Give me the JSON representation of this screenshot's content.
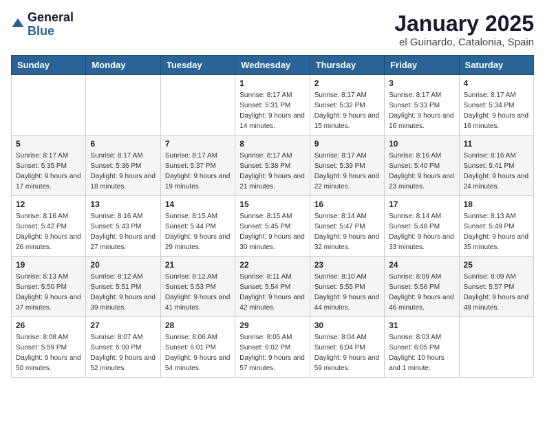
{
  "logo": {
    "general": "General",
    "blue": "Blue"
  },
  "header": {
    "month": "January 2025",
    "location": "el Guinardo, Catalonia, Spain"
  },
  "weekdays": [
    "Sunday",
    "Monday",
    "Tuesday",
    "Wednesday",
    "Thursday",
    "Friday",
    "Saturday"
  ],
  "weeks": [
    [
      {
        "day": "",
        "sunrise": "",
        "sunset": "",
        "daylight": ""
      },
      {
        "day": "",
        "sunrise": "",
        "sunset": "",
        "daylight": ""
      },
      {
        "day": "",
        "sunrise": "",
        "sunset": "",
        "daylight": ""
      },
      {
        "day": "1",
        "sunrise": "Sunrise: 8:17 AM",
        "sunset": "Sunset: 5:31 PM",
        "daylight": "Daylight: 9 hours and 14 minutes."
      },
      {
        "day": "2",
        "sunrise": "Sunrise: 8:17 AM",
        "sunset": "Sunset: 5:32 PM",
        "daylight": "Daylight: 9 hours and 15 minutes."
      },
      {
        "day": "3",
        "sunrise": "Sunrise: 8:17 AM",
        "sunset": "Sunset: 5:33 PM",
        "daylight": "Daylight: 9 hours and 16 minutes."
      },
      {
        "day": "4",
        "sunrise": "Sunrise: 8:17 AM",
        "sunset": "Sunset: 5:34 PM",
        "daylight": "Daylight: 9 hours and 16 minutes."
      }
    ],
    [
      {
        "day": "5",
        "sunrise": "Sunrise: 8:17 AM",
        "sunset": "Sunset: 5:35 PM",
        "daylight": "Daylight: 9 hours and 17 minutes."
      },
      {
        "day": "6",
        "sunrise": "Sunrise: 8:17 AM",
        "sunset": "Sunset: 5:36 PM",
        "daylight": "Daylight: 9 hours and 18 minutes."
      },
      {
        "day": "7",
        "sunrise": "Sunrise: 8:17 AM",
        "sunset": "Sunset: 5:37 PM",
        "daylight": "Daylight: 9 hours and 19 minutes."
      },
      {
        "day": "8",
        "sunrise": "Sunrise: 8:17 AM",
        "sunset": "Sunset: 5:38 PM",
        "daylight": "Daylight: 9 hours and 21 minutes."
      },
      {
        "day": "9",
        "sunrise": "Sunrise: 8:17 AM",
        "sunset": "Sunset: 5:39 PM",
        "daylight": "Daylight: 9 hours and 22 minutes."
      },
      {
        "day": "10",
        "sunrise": "Sunrise: 8:16 AM",
        "sunset": "Sunset: 5:40 PM",
        "daylight": "Daylight: 9 hours and 23 minutes."
      },
      {
        "day": "11",
        "sunrise": "Sunrise: 8:16 AM",
        "sunset": "Sunset: 5:41 PM",
        "daylight": "Daylight: 9 hours and 24 minutes."
      }
    ],
    [
      {
        "day": "12",
        "sunrise": "Sunrise: 8:16 AM",
        "sunset": "Sunset: 5:42 PM",
        "daylight": "Daylight: 9 hours and 26 minutes."
      },
      {
        "day": "13",
        "sunrise": "Sunrise: 8:16 AM",
        "sunset": "Sunset: 5:43 PM",
        "daylight": "Daylight: 9 hours and 27 minutes."
      },
      {
        "day": "14",
        "sunrise": "Sunrise: 8:15 AM",
        "sunset": "Sunset: 5:44 PM",
        "daylight": "Daylight: 9 hours and 29 minutes."
      },
      {
        "day": "15",
        "sunrise": "Sunrise: 8:15 AM",
        "sunset": "Sunset: 5:45 PM",
        "daylight": "Daylight: 9 hours and 30 minutes."
      },
      {
        "day": "16",
        "sunrise": "Sunrise: 8:14 AM",
        "sunset": "Sunset: 5:47 PM",
        "daylight": "Daylight: 9 hours and 32 minutes."
      },
      {
        "day": "17",
        "sunrise": "Sunrise: 8:14 AM",
        "sunset": "Sunset: 5:48 PM",
        "daylight": "Daylight: 9 hours and 33 minutes."
      },
      {
        "day": "18",
        "sunrise": "Sunrise: 8:13 AM",
        "sunset": "Sunset: 5:49 PM",
        "daylight": "Daylight: 9 hours and 35 minutes."
      }
    ],
    [
      {
        "day": "19",
        "sunrise": "Sunrise: 8:13 AM",
        "sunset": "Sunset: 5:50 PM",
        "daylight": "Daylight: 9 hours and 37 minutes."
      },
      {
        "day": "20",
        "sunrise": "Sunrise: 8:12 AM",
        "sunset": "Sunset: 5:51 PM",
        "daylight": "Daylight: 9 hours and 39 minutes."
      },
      {
        "day": "21",
        "sunrise": "Sunrise: 8:12 AM",
        "sunset": "Sunset: 5:53 PM",
        "daylight": "Daylight: 9 hours and 41 minutes."
      },
      {
        "day": "22",
        "sunrise": "Sunrise: 8:11 AM",
        "sunset": "Sunset: 5:54 PM",
        "daylight": "Daylight: 9 hours and 42 minutes."
      },
      {
        "day": "23",
        "sunrise": "Sunrise: 8:10 AM",
        "sunset": "Sunset: 5:55 PM",
        "daylight": "Daylight: 9 hours and 44 minutes."
      },
      {
        "day": "24",
        "sunrise": "Sunrise: 8:09 AM",
        "sunset": "Sunset: 5:56 PM",
        "daylight": "Daylight: 9 hours and 46 minutes."
      },
      {
        "day": "25",
        "sunrise": "Sunrise: 8:09 AM",
        "sunset": "Sunset: 5:57 PM",
        "daylight": "Daylight: 9 hours and 48 minutes."
      }
    ],
    [
      {
        "day": "26",
        "sunrise": "Sunrise: 8:08 AM",
        "sunset": "Sunset: 5:59 PM",
        "daylight": "Daylight: 9 hours and 50 minutes."
      },
      {
        "day": "27",
        "sunrise": "Sunrise: 8:07 AM",
        "sunset": "Sunset: 6:00 PM",
        "daylight": "Daylight: 9 hours and 52 minutes."
      },
      {
        "day": "28",
        "sunrise": "Sunrise: 8:06 AM",
        "sunset": "Sunset: 6:01 PM",
        "daylight": "Daylight: 9 hours and 54 minutes."
      },
      {
        "day": "29",
        "sunrise": "Sunrise: 8:05 AM",
        "sunset": "Sunset: 6:02 PM",
        "daylight": "Daylight: 9 hours and 57 minutes."
      },
      {
        "day": "30",
        "sunrise": "Sunrise: 8:04 AM",
        "sunset": "Sunset: 6:04 PM",
        "daylight": "Daylight: 9 hours and 59 minutes."
      },
      {
        "day": "31",
        "sunrise": "Sunrise: 8:03 AM",
        "sunset": "Sunset: 6:05 PM",
        "daylight": "Daylight: 10 hours and 1 minute."
      },
      {
        "day": "",
        "sunrise": "",
        "sunset": "",
        "daylight": ""
      }
    ]
  ]
}
